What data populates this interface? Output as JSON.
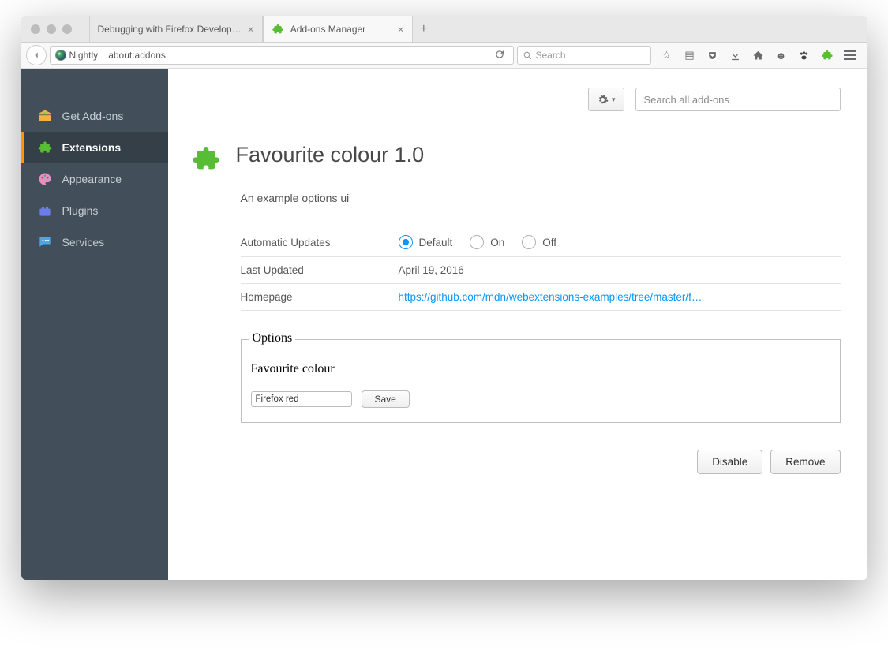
{
  "window": {
    "tabs": [
      {
        "label": "Debugging with Firefox Develop…",
        "active": false
      },
      {
        "label": "Add-ons Manager",
        "active": true
      }
    ]
  },
  "urlbar": {
    "identity_label": "Nightly",
    "address": "about:addons",
    "search_placeholder": "Search"
  },
  "sidebar": {
    "items": [
      {
        "id": "get-addons",
        "label": "Get Add-ons"
      },
      {
        "id": "extensions",
        "label": "Extensions",
        "active": true
      },
      {
        "id": "appearance",
        "label": "Appearance"
      },
      {
        "id": "plugins",
        "label": "Plugins"
      },
      {
        "id": "services",
        "label": "Services"
      }
    ]
  },
  "topcontrols": {
    "search_placeholder": "Search all add-ons"
  },
  "addon": {
    "name": "Favourite colour",
    "version": "1.0",
    "description": "An example options ui",
    "details": {
      "auto_updates_label": "Automatic Updates",
      "auto_updates_options": {
        "default": "Default",
        "on": "On",
        "off": "Off"
      },
      "auto_updates_selected": "default",
      "last_updated_label": "Last Updated",
      "last_updated_value": "April 19, 2016",
      "homepage_label": "Homepage",
      "homepage_value": "https://github.com/mdn/webextensions-examples/tree/master/f…"
    },
    "options_panel": {
      "legend": "Options",
      "field_label": "Favourite colour",
      "field_value": "Firefox red",
      "save_label": "Save"
    },
    "actions": {
      "disable": "Disable",
      "remove": "Remove"
    }
  }
}
